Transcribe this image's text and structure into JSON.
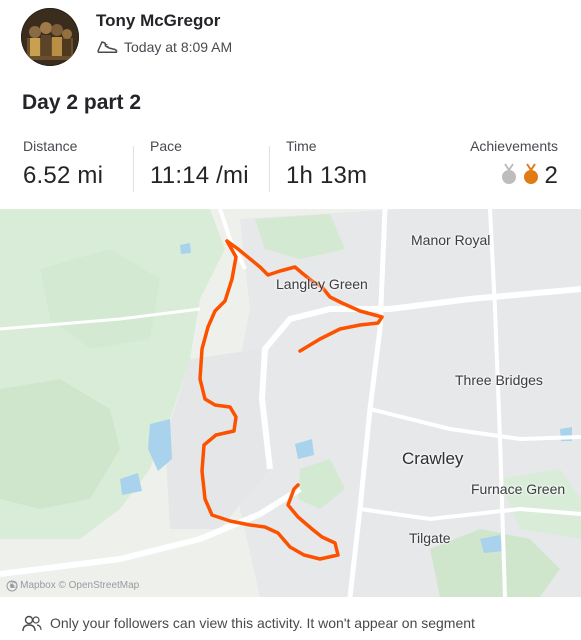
{
  "athlete": {
    "name": "Tony McGregor",
    "avatar_icon": "group-photo-avatar"
  },
  "activity": {
    "type_icon": "shoe-icon",
    "timestamp": "Today at 8:09 AM",
    "title": "Day 2 part 2"
  },
  "stats": {
    "distance": {
      "label": "Distance",
      "value": "6.52 mi"
    },
    "pace": {
      "label": "Pace",
      "value": "11:14 /mi"
    },
    "time": {
      "label": "Time",
      "value": "1h 13m"
    },
    "achievements": {
      "label": "Achievements",
      "count": "2",
      "medal_colors": [
        "#bdbdbd",
        "#e07b16"
      ]
    }
  },
  "map": {
    "places": {
      "manor_royal": "Manor Royal",
      "langley_green": "Langley Green",
      "three_bridges": "Three Bridges",
      "crawley": "Crawley",
      "furnace_green": "Furnace Green",
      "tilgate": "Tilgate"
    },
    "attribution": "© Mapbox © OpenStreetMap",
    "route_color": "#fc5200"
  },
  "footer": {
    "privacy_icon": "followers-icon",
    "privacy_text": "Only your followers can view this activity. It won't appear on segment"
  }
}
